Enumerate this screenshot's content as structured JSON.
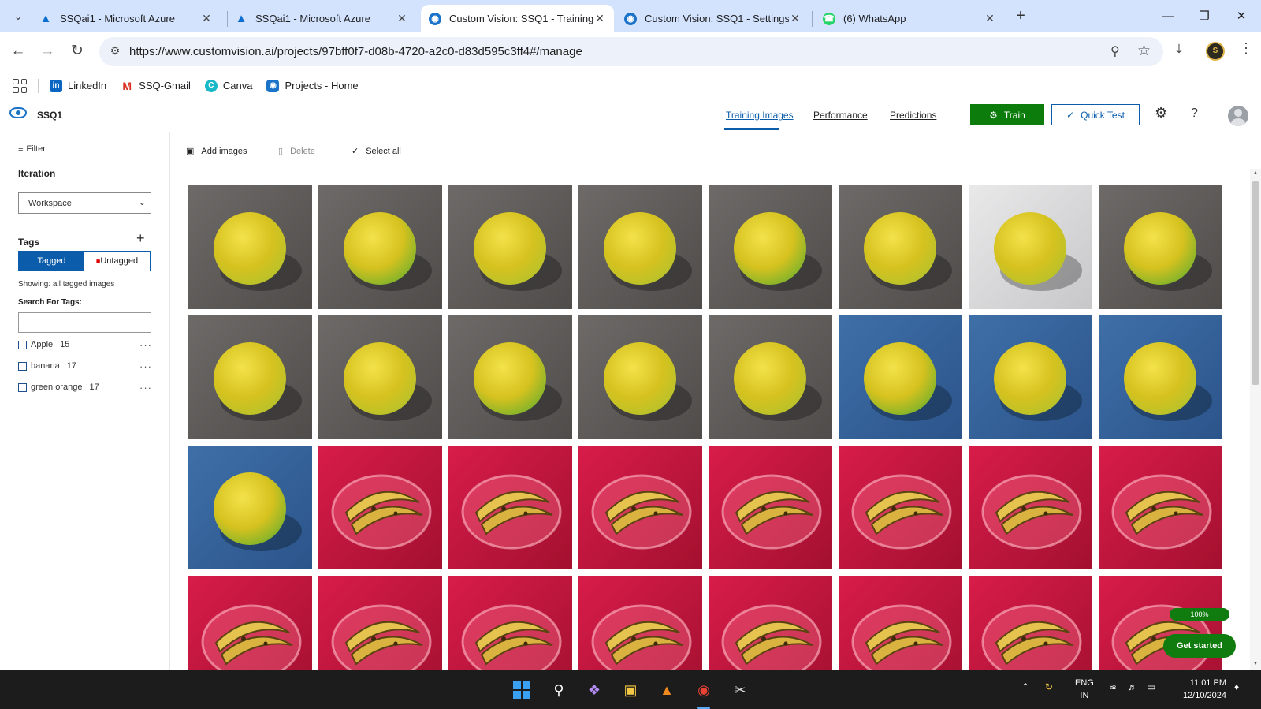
{
  "browser": {
    "tabs": [
      {
        "title": "SSQai1 - Microsoft Azure",
        "favicon": "azure-icon"
      },
      {
        "title": "SSQai1 - Microsoft Azure",
        "favicon": "azure-icon"
      },
      {
        "title": "Custom Vision: SSQ1 - Training",
        "favicon": "custom-vision-icon",
        "active": true
      },
      {
        "title": "Custom Vision: SSQ1 - Settings",
        "favicon": "custom-vision-icon"
      },
      {
        "title": "(6) WhatsApp",
        "favicon": "whatsapp-icon"
      }
    ],
    "url": "https://www.customvision.ai/projects/97bff0f7-d08b-4720-a2c0-d83d595c3ff4#/manage",
    "bookmarks": [
      {
        "label": "LinkedIn",
        "icon": "linkedin-icon"
      },
      {
        "label": "SSQ-Gmail",
        "icon": "gmail-icon"
      },
      {
        "label": "Canva",
        "icon": "canva-icon"
      },
      {
        "label": "Projects - Home",
        "icon": "projects-icon"
      }
    ]
  },
  "app": {
    "project_name": "SSQ1",
    "nav": [
      {
        "label": "Training Images",
        "active": true
      },
      {
        "label": "Performance"
      },
      {
        "label": "Predictions"
      }
    ],
    "train_label": "Train",
    "quick_test_label": "Quick Test",
    "accent_color": "#0b5cab",
    "train_color": "#0c7d0c"
  },
  "sidebar": {
    "filter_label": "Filter",
    "iteration_heading": "Iteration",
    "iteration_value": "Workspace",
    "tags_heading": "Tags",
    "tagged_label": "Tagged",
    "untagged_label": "Untagged",
    "showing_text": "Showing: all tagged images",
    "search_label": "Search For Tags:",
    "search_value": "",
    "tags": [
      {
        "name": "Apple",
        "count": "15"
      },
      {
        "name": "banana",
        "count": "17"
      },
      {
        "name": "green orange",
        "count": "17"
      }
    ]
  },
  "main": {
    "add_images_label": "Add images",
    "delete_label": "Delete",
    "select_all_label": "Select all",
    "images": [
      {
        "subject": "orange",
        "background": "floor"
      },
      {
        "subject": "orange",
        "background": "floor"
      },
      {
        "subject": "orange",
        "background": "floor"
      },
      {
        "subject": "orange",
        "background": "floor"
      },
      {
        "subject": "orange",
        "background": "floor"
      },
      {
        "subject": "orange",
        "background": "floor"
      },
      {
        "subject": "orange",
        "background": "white"
      },
      {
        "subject": "orange",
        "background": "floor"
      },
      {
        "subject": "orange",
        "background": "floor"
      },
      {
        "subject": "orange",
        "background": "floor"
      },
      {
        "subject": "orange",
        "background": "floor"
      },
      {
        "subject": "orange",
        "background": "floor"
      },
      {
        "subject": "orange",
        "background": "floor"
      },
      {
        "subject": "orange",
        "background": "denim"
      },
      {
        "subject": "orange",
        "background": "denim"
      },
      {
        "subject": "orange",
        "background": "denim"
      },
      {
        "subject": "orange",
        "background": "denim"
      },
      {
        "subject": "banana",
        "background": "red-cloth"
      },
      {
        "subject": "banana",
        "background": "red-cloth"
      },
      {
        "subject": "banana",
        "background": "red-cloth"
      },
      {
        "subject": "banana",
        "background": "red-cloth"
      },
      {
        "subject": "banana",
        "background": "red-cloth"
      },
      {
        "subject": "banana",
        "background": "red-cloth"
      },
      {
        "subject": "banana",
        "background": "red-cloth"
      },
      {
        "subject": "banana",
        "background": "red-cloth"
      },
      {
        "subject": "banana",
        "background": "red-cloth"
      },
      {
        "subject": "banana",
        "background": "red-cloth"
      },
      {
        "subject": "banana",
        "background": "red-cloth"
      },
      {
        "subject": "banana",
        "background": "red-cloth"
      },
      {
        "subject": "banana",
        "background": "red-cloth"
      },
      {
        "subject": "banana",
        "background": "red-cloth"
      },
      {
        "subject": "banana",
        "background": "red-cloth"
      }
    ]
  },
  "onboarding": {
    "progress_label": "100%",
    "progress": 1.0,
    "get_started_label": "Get started"
  },
  "taskbar": {
    "language_line1": "ENG",
    "language_line2": "IN",
    "time": "11:01 PM",
    "date": "12/10/2024"
  }
}
